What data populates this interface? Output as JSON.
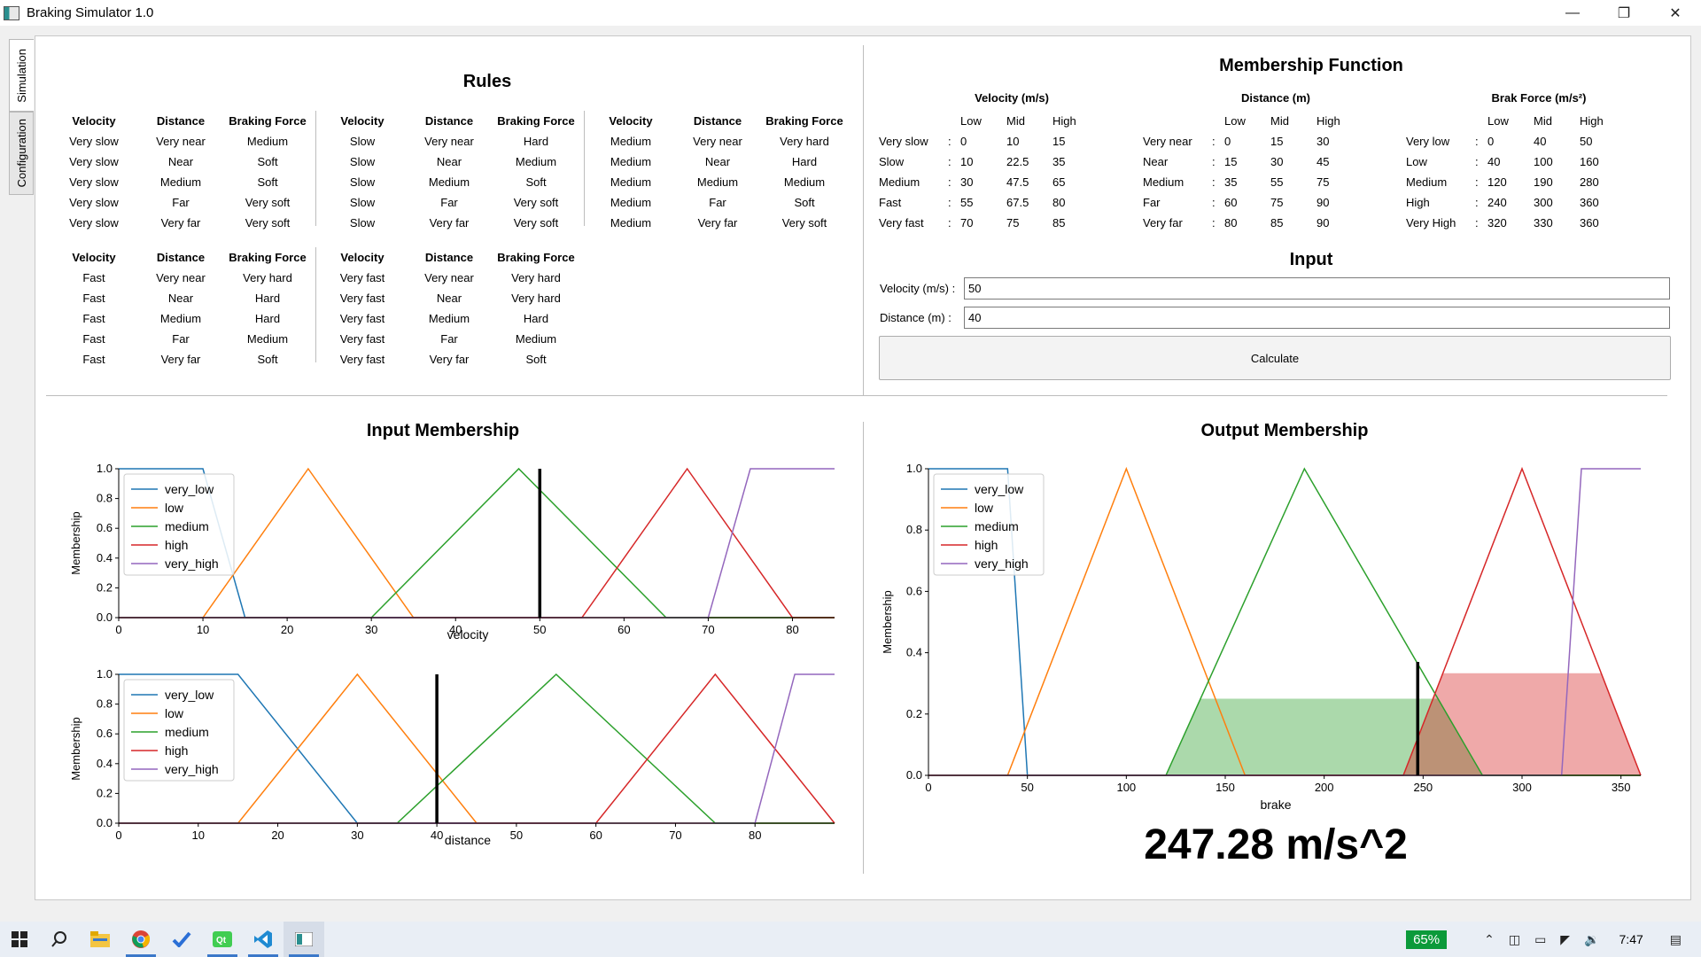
{
  "window": {
    "title": "Braking Simulator 1.0"
  },
  "tabs": [
    {
      "label": "Simulation"
    },
    {
      "label": "Configuration"
    }
  ],
  "rules": {
    "title": "Rules",
    "headers": {
      "velocity": "Velocity",
      "distance": "Distance",
      "force": "Braking Force"
    },
    "groups": [
      {
        "rows": [
          [
            "Very slow",
            "Very near",
            "Medium"
          ],
          [
            "Very slow",
            "Near",
            "Soft"
          ],
          [
            "Very slow",
            "Medium",
            "Soft"
          ],
          [
            "Very slow",
            "Far",
            "Very soft"
          ],
          [
            "Very slow",
            "Very far",
            "Very soft"
          ]
        ]
      },
      {
        "rows": [
          [
            "Slow",
            "Very near",
            "Hard"
          ],
          [
            "Slow",
            "Near",
            "Medium"
          ],
          [
            "Slow",
            "Medium",
            "Soft"
          ],
          [
            "Slow",
            "Far",
            "Very soft"
          ],
          [
            "Slow",
            "Very far",
            "Very soft"
          ]
        ]
      },
      {
        "rows": [
          [
            "Medium",
            "Very near",
            "Very hard"
          ],
          [
            "Medium",
            "Near",
            "Hard"
          ],
          [
            "Medium",
            "Medium",
            "Medium"
          ],
          [
            "Medium",
            "Far",
            "Soft"
          ],
          [
            "Medium",
            "Very far",
            "Very soft"
          ]
        ]
      },
      {
        "rows": [
          [
            "Fast",
            "Very near",
            "Very hard"
          ],
          [
            "Fast",
            "Near",
            "Hard"
          ],
          [
            "Fast",
            "Medium",
            "Hard"
          ],
          [
            "Fast",
            "Far",
            "Medium"
          ],
          [
            "Fast",
            "Very far",
            "Soft"
          ]
        ]
      },
      {
        "rows": [
          [
            "Very fast",
            "Very near",
            "Very hard"
          ],
          [
            "Very fast",
            "Near",
            "Very hard"
          ],
          [
            "Very fast",
            "Medium",
            "Hard"
          ],
          [
            "Very fast",
            "Far",
            "Medium"
          ],
          [
            "Very fast",
            "Very far",
            "Soft"
          ]
        ]
      }
    ]
  },
  "membership": {
    "title": "Membership Function",
    "col_headers": [
      "Low",
      "Mid",
      "High"
    ],
    "tables": [
      {
        "title": "Velocity (m/s)",
        "rows": [
          [
            "Very slow",
            "0",
            "10",
            "15"
          ],
          [
            "Slow",
            "10",
            "22.5",
            "35"
          ],
          [
            "Medium",
            "30",
            "47.5",
            "65"
          ],
          [
            "Fast",
            "55",
            "67.5",
            "80"
          ],
          [
            "Very fast",
            "70",
            "75",
            "85"
          ]
        ]
      },
      {
        "title": "Distance (m)",
        "rows": [
          [
            "Very near",
            "0",
            "15",
            "30"
          ],
          [
            "Near",
            "15",
            "30",
            "45"
          ],
          [
            "Medium",
            "35",
            "55",
            "75"
          ],
          [
            "Far",
            "60",
            "75",
            "90"
          ],
          [
            "Very far",
            "80",
            "85",
            "90"
          ]
        ]
      },
      {
        "title": "Brak Force (m/s²)",
        "rows": [
          [
            "Very low",
            "0",
            "40",
            "50"
          ],
          [
            "Low",
            "40",
            "100",
            "160"
          ],
          [
            "Medium",
            "120",
            "190",
            "280"
          ],
          [
            "High",
            "240",
            "300",
            "360"
          ],
          [
            "Very High",
            "320",
            "330",
            "360"
          ]
        ]
      }
    ]
  },
  "input": {
    "title": "Input",
    "velocity_label": "Velocity (m/s) :",
    "velocity_value": "50",
    "distance_label": "Distance (m) :",
    "distance_value": "40",
    "calculate_label": "Calculate"
  },
  "input_membership": {
    "title": "Input Membership"
  },
  "output_membership": {
    "title": "Output Membership"
  },
  "result": "247.28 m/s^2",
  "chart_data": [
    {
      "type": "line",
      "ylabel": "Membership",
      "xlabel": "velocity",
      "xlim": [
        0,
        85
      ],
      "ylim": [
        0,
        1
      ],
      "xticks": [
        0,
        10,
        20,
        30,
        40,
        50,
        60,
        70,
        80
      ],
      "yticks": [
        0.0,
        0.2,
        0.4,
        0.6,
        0.8,
        1.0
      ],
      "legend": "top-left",
      "series": [
        {
          "name": "very_low",
          "color": "#1f77b4",
          "points": [
            [
              0,
              1
            ],
            [
              10,
              1
            ],
            [
              15,
              0
            ],
            [
              85,
              0
            ]
          ]
        },
        {
          "name": "low",
          "color": "#ff7f0e",
          "points": [
            [
              0,
              0
            ],
            [
              10,
              0
            ],
            [
              22.5,
              1
            ],
            [
              35,
              0
            ],
            [
              85,
              0
            ]
          ]
        },
        {
          "name": "medium",
          "color": "#2ca02c",
          "points": [
            [
              0,
              0
            ],
            [
              30,
              0
            ],
            [
              47.5,
              1
            ],
            [
              65,
              0
            ],
            [
              85,
              0
            ]
          ]
        },
        {
          "name": "high",
          "color": "#d62728",
          "points": [
            [
              0,
              0
            ],
            [
              55,
              0
            ],
            [
              67.5,
              1
            ],
            [
              80,
              0
            ],
            [
              85,
              0
            ]
          ]
        },
        {
          "name": "very_high",
          "color": "#9467bd",
          "points": [
            [
              0,
              0
            ],
            [
              70,
              0
            ],
            [
              75,
              1
            ],
            [
              85,
              1
            ]
          ]
        }
      ],
      "marker_x": 50
    },
    {
      "type": "line",
      "ylabel": "Membership",
      "xlabel": "distance",
      "xlim": [
        0,
        90
      ],
      "ylim": [
        0,
        1
      ],
      "xticks": [
        0,
        10,
        20,
        30,
        40,
        50,
        60,
        70,
        80
      ],
      "yticks": [
        0.0,
        0.2,
        0.4,
        0.6,
        0.8,
        1.0
      ],
      "legend": "top-left",
      "series": [
        {
          "name": "very_low",
          "color": "#1f77b4",
          "points": [
            [
              0,
              1
            ],
            [
              15,
              1
            ],
            [
              30,
              0
            ],
            [
              90,
              0
            ]
          ]
        },
        {
          "name": "low",
          "color": "#ff7f0e",
          "points": [
            [
              0,
              0
            ],
            [
              15,
              0
            ],
            [
              30,
              1
            ],
            [
              45,
              0
            ],
            [
              90,
              0
            ]
          ]
        },
        {
          "name": "medium",
          "color": "#2ca02c",
          "points": [
            [
              0,
              0
            ],
            [
              35,
              0
            ],
            [
              55,
              1
            ],
            [
              75,
              0
            ],
            [
              90,
              0
            ]
          ]
        },
        {
          "name": "high",
          "color": "#d62728",
          "points": [
            [
              0,
              0
            ],
            [
              60,
              0
            ],
            [
              75,
              1
            ],
            [
              90,
              0
            ]
          ]
        },
        {
          "name": "very_high",
          "color": "#9467bd",
          "points": [
            [
              0,
              0
            ],
            [
              80,
              0
            ],
            [
              85,
              1
            ],
            [
              90,
              1
            ]
          ]
        }
      ],
      "marker_x": 40
    },
    {
      "type": "area",
      "ylabel": "Membership",
      "xlabel": "brake",
      "xlim": [
        0,
        360
      ],
      "ylim": [
        0,
        1
      ],
      "xticks": [
        0,
        50,
        100,
        150,
        200,
        250,
        300,
        350
      ],
      "yticks": [
        0.0,
        0.2,
        0.4,
        0.6,
        0.8,
        1.0
      ],
      "legend": "top-left",
      "series": [
        {
          "name": "very_low",
          "color": "#1f77b4",
          "points": [
            [
              0,
              1
            ],
            [
              40,
              1
            ],
            [
              50,
              0
            ],
            [
              360,
              0
            ]
          ]
        },
        {
          "name": "low",
          "color": "#ff7f0e",
          "points": [
            [
              0,
              0
            ],
            [
              40,
              0
            ],
            [
              100,
              1
            ],
            [
              160,
              0
            ],
            [
              360,
              0
            ]
          ]
        },
        {
          "name": "medium",
          "color": "#2ca02c",
          "points": [
            [
              0,
              0
            ],
            [
              120,
              0
            ],
            [
              190,
              1
            ],
            [
              280,
              0
            ],
            [
              360,
              0
            ]
          ]
        },
        {
          "name": "high",
          "color": "#d62728",
          "points": [
            [
              0,
              0
            ],
            [
              240,
              0
            ],
            [
              300,
              1
            ],
            [
              360,
              0
            ]
          ]
        },
        {
          "name": "very_high",
          "color": "#9467bd",
          "points": [
            [
              0,
              0
            ],
            [
              320,
              0
            ],
            [
              330,
              1
            ],
            [
              360,
              1
            ]
          ]
        }
      ],
      "filled": [
        {
          "color": "#2ca02c",
          "points": [
            [
              120,
              0
            ],
            [
              137.5,
              0.25
            ],
            [
              257.5,
              0.25
            ],
            [
              280,
              0
            ]
          ]
        },
        {
          "color": "#d62728",
          "points": [
            [
              240,
              0
            ],
            [
              260,
              0.333
            ],
            [
              340,
              0.333
            ],
            [
              360,
              0
            ]
          ]
        }
      ],
      "marker_x": 247.28,
      "marker_height": 0.37
    }
  ],
  "taskbar": {
    "battery": "65%",
    "clock": "7:47"
  }
}
